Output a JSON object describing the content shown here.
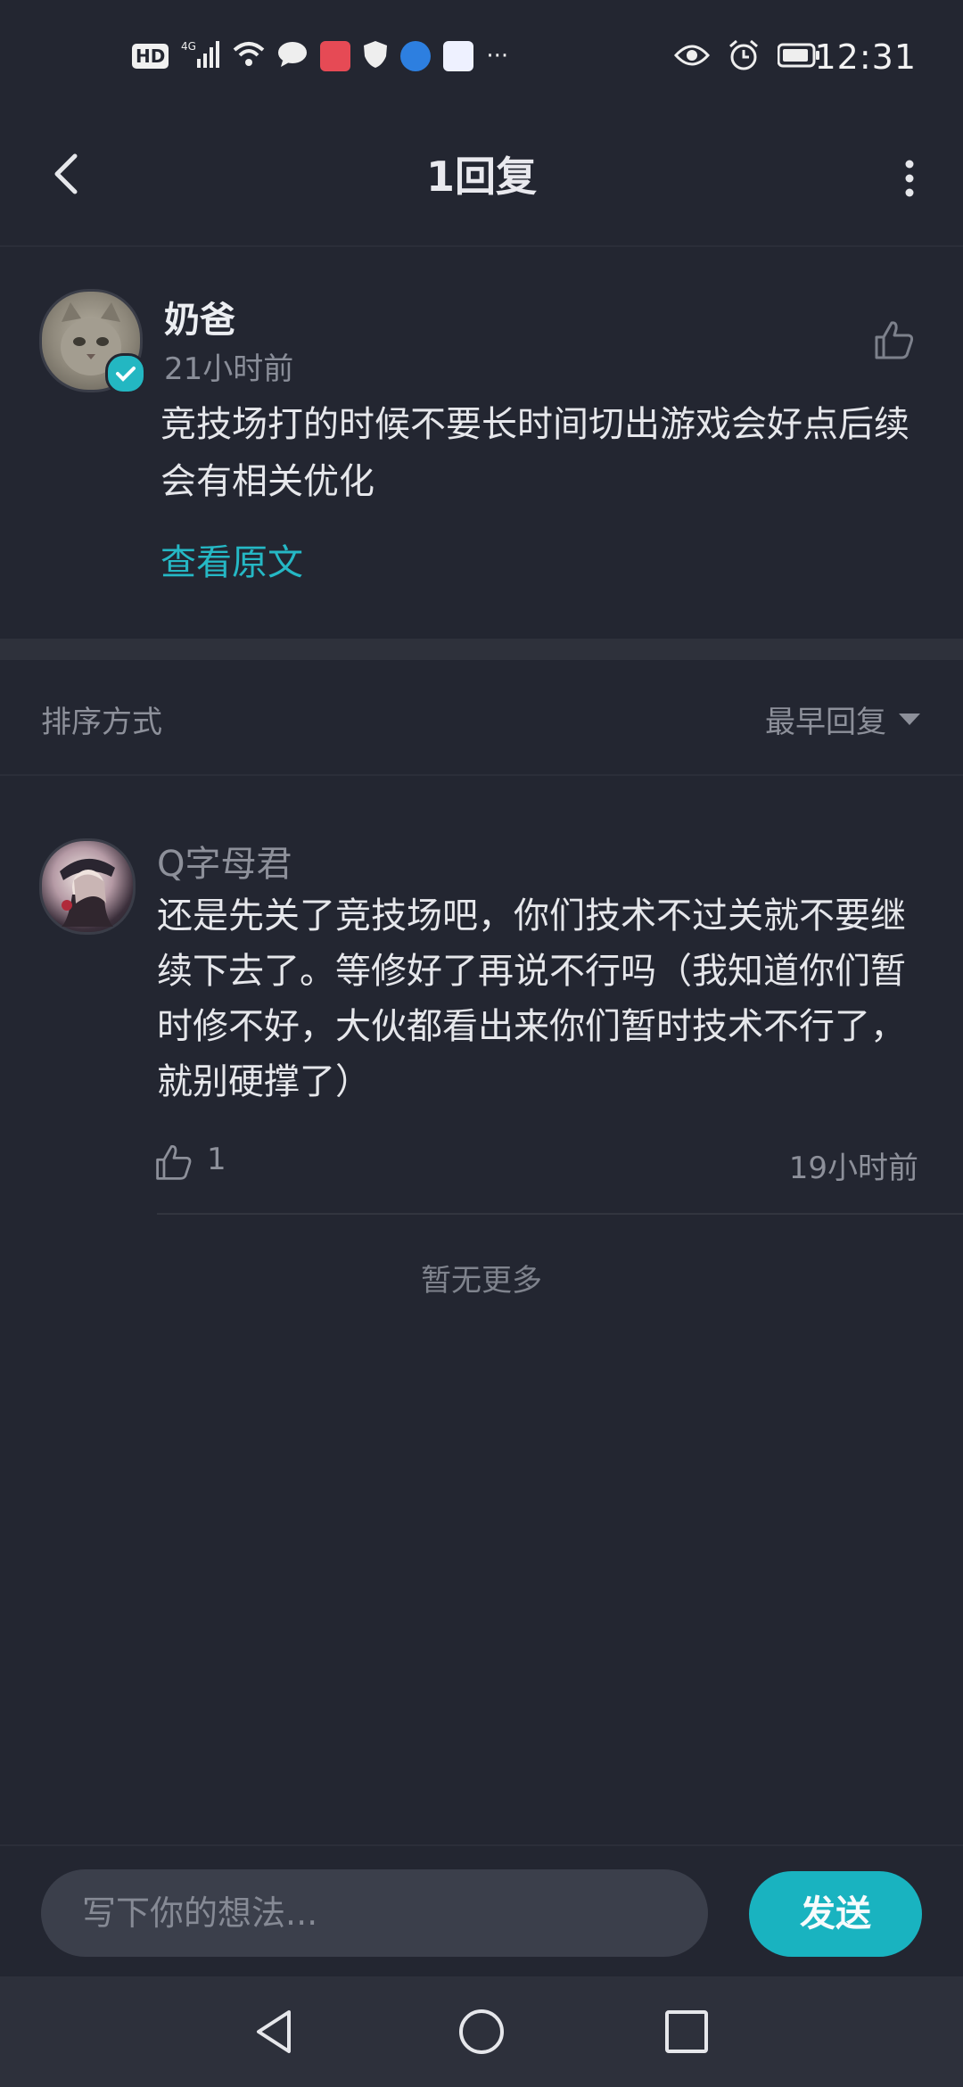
{
  "status_bar": {
    "time": "12:31",
    "left_labels": {
      "hd": "HD",
      "network": "4G"
    },
    "icons": [
      "hd-icon",
      "signal-icon",
      "wifi-icon",
      "message-icon",
      "book-icon",
      "shield-icon",
      "browser-icon",
      "hash-icon",
      "more-dots-icon",
      "eye-icon",
      "alarm-icon",
      "battery-icon"
    ],
    "overflow_label": "···"
  },
  "header": {
    "title": "1回复",
    "back_icon": "chevron-left-icon",
    "menu_icon": "more-vertical-icon"
  },
  "original_comment": {
    "author": "奶爸",
    "time": "21小时前",
    "text": "竞技场打的时候不要长时间切出游戏会好点后续会有相关优化",
    "view_original": "查看原文"
  },
  "sort": {
    "label": "排序方式",
    "value": "最早回复"
  },
  "replies": [
    {
      "author": "Q字母君",
      "text": "还是先关了竞技场吧，你们技术不过关就不要继续下去了。等修好了再说不行吗（我知道你们暂时修不好，大伙都看出来你们暂时技术不行了，就别硬撑了）",
      "likes": "1",
      "time": "19小时前"
    }
  ],
  "footer_note": "暂无更多",
  "composer": {
    "placeholder": "写下你的想法...",
    "send_label": "发送"
  },
  "colors": {
    "background": "#232631",
    "accent": "#19b3c0",
    "link": "#25b8c5",
    "input_bg": "#3b3f4b",
    "nav_bg": "#2d303b"
  }
}
